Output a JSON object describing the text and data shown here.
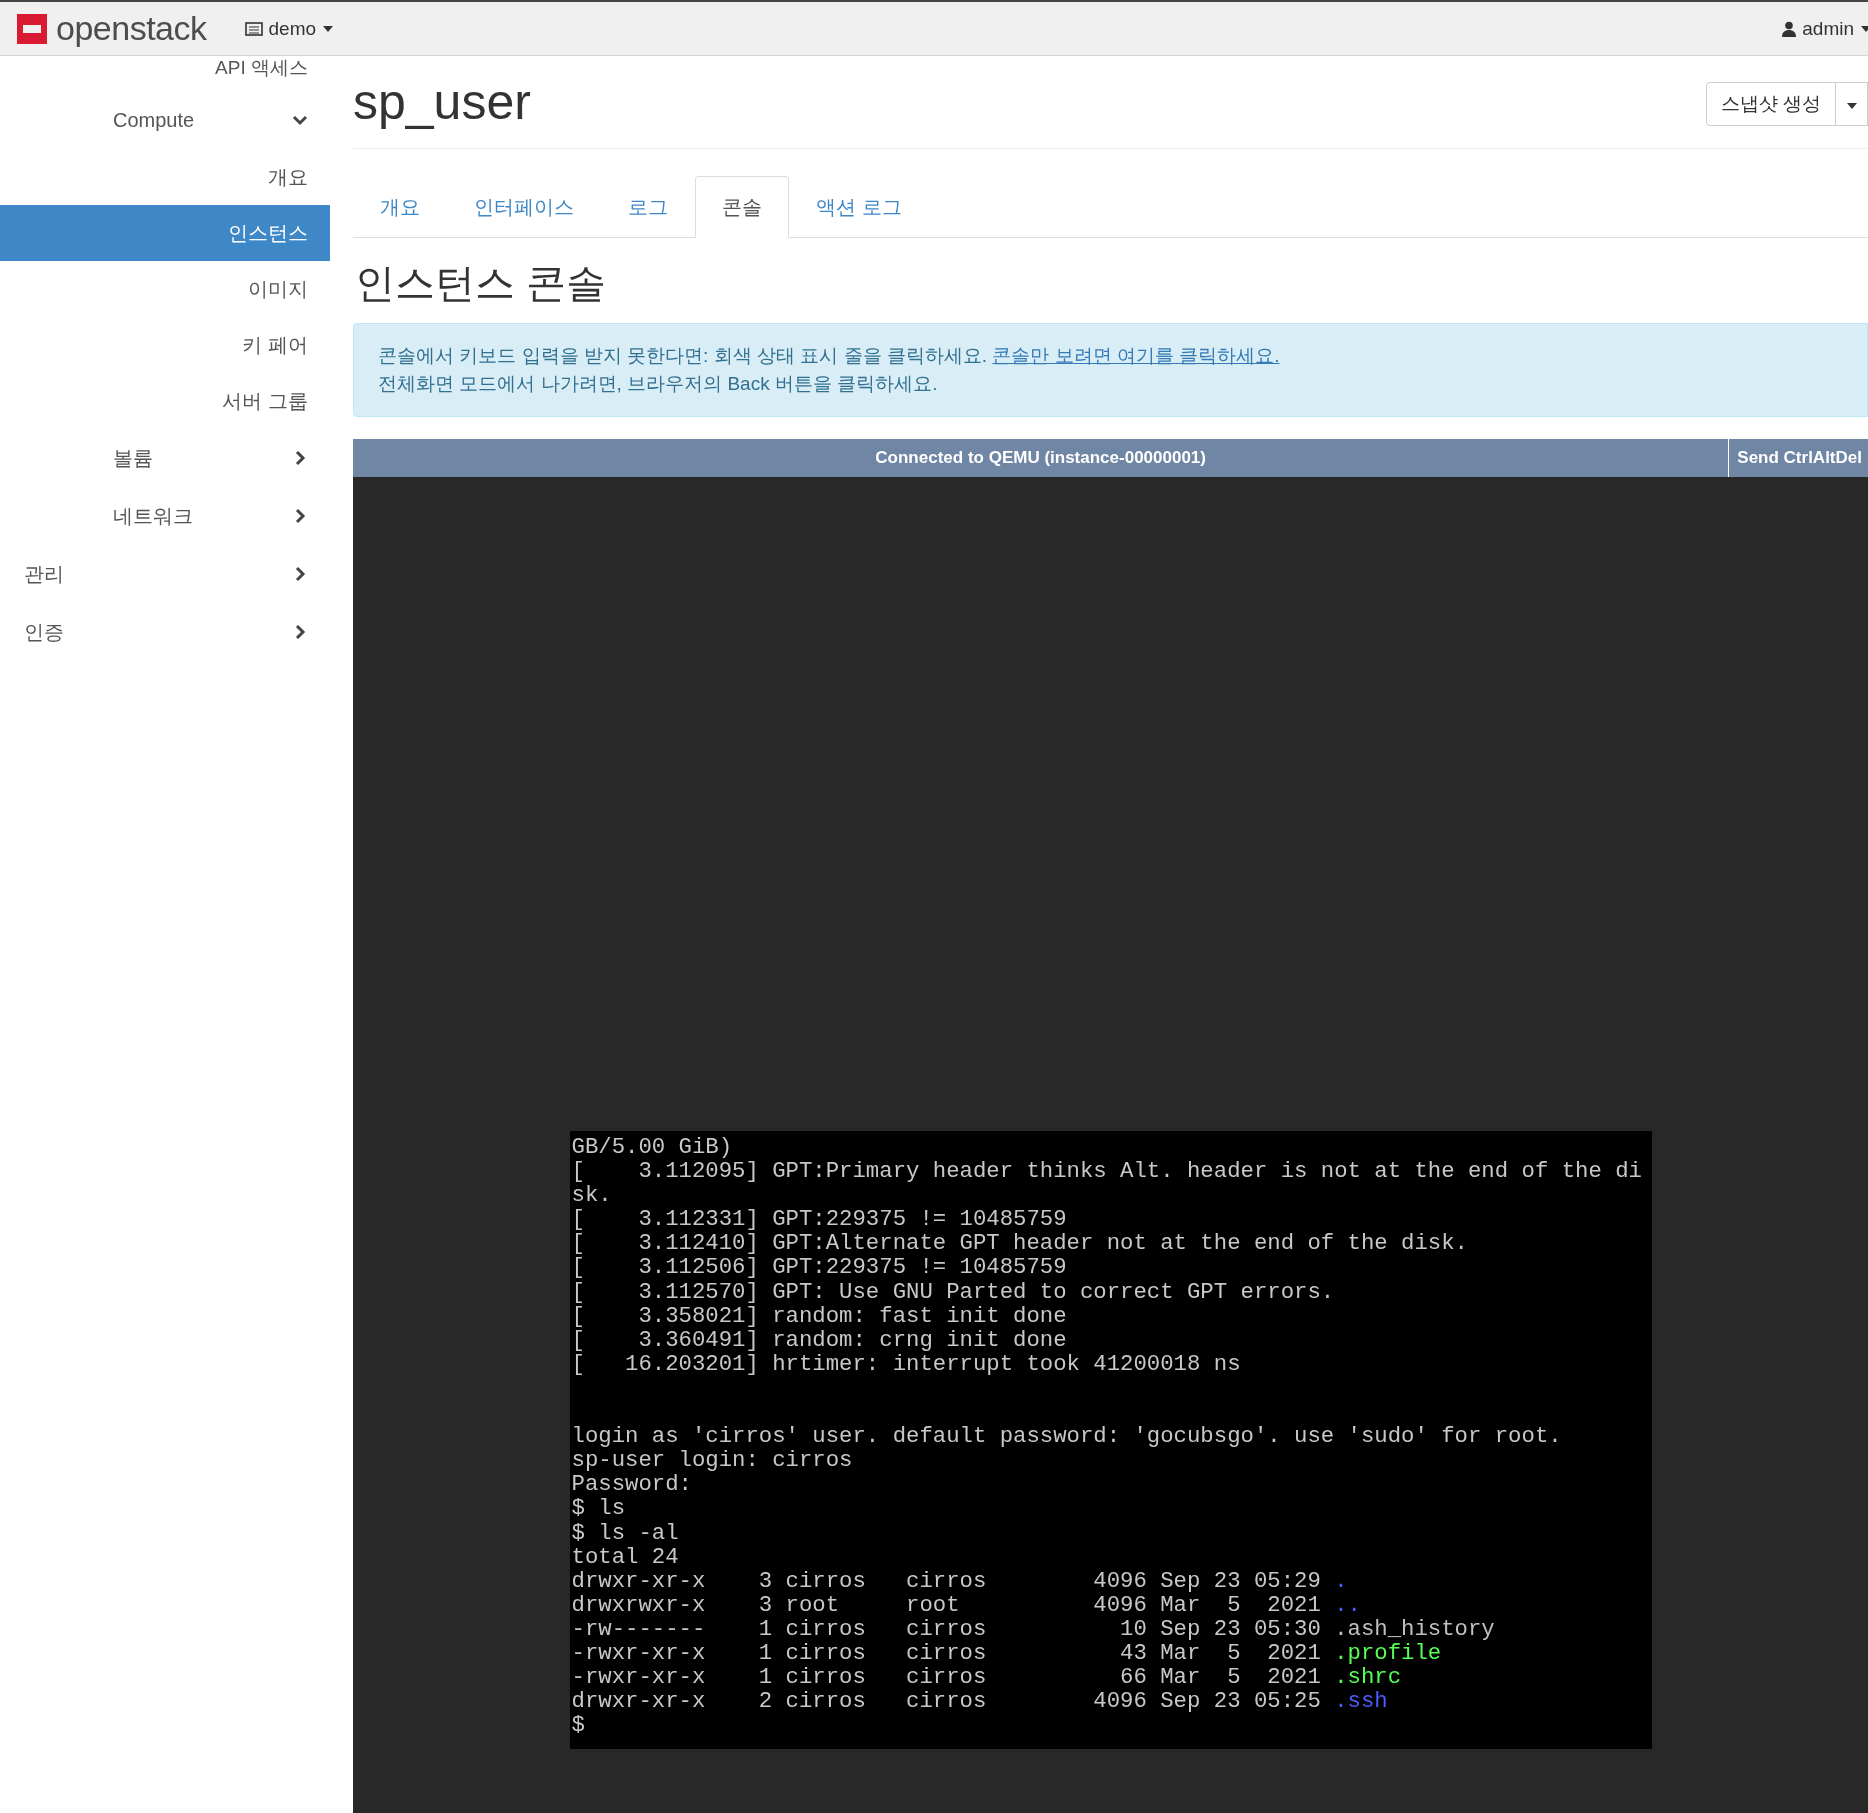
{
  "header": {
    "logo": "openstack",
    "project": "demo",
    "user": "admin"
  },
  "sidebar": {
    "items": [
      {
        "label": "API 액세스",
        "kind": "sub",
        "selected": false
      },
      {
        "label": "Compute",
        "kind": "group",
        "expanded": true,
        "selected": false
      },
      {
        "label": "개요",
        "kind": "sub",
        "selected": false
      },
      {
        "label": "인스턴스",
        "kind": "sub",
        "selected": true
      },
      {
        "label": "이미지",
        "kind": "sub",
        "selected": false
      },
      {
        "label": "키 페어",
        "kind": "sub",
        "selected": false
      },
      {
        "label": "서버 그룹",
        "kind": "sub",
        "selected": false
      },
      {
        "label": "볼륨",
        "kind": "group",
        "expanded": false,
        "selected": false
      },
      {
        "label": "네트워크",
        "kind": "group",
        "expanded": false,
        "selected": false
      },
      {
        "label": "관리",
        "kind": "top",
        "expanded": false,
        "selected": false
      },
      {
        "label": "인증",
        "kind": "top",
        "expanded": false,
        "selected": false
      }
    ]
  },
  "page": {
    "title": "sp_user",
    "action_button": "스냅샷 생성"
  },
  "tabs": [
    {
      "label": "개요",
      "selected": false
    },
    {
      "label": "인터페이스",
      "selected": false
    },
    {
      "label": "로그",
      "selected": false
    },
    {
      "label": "콘솔",
      "selected": true
    },
    {
      "label": "액션 로그",
      "selected": false
    }
  ],
  "section_title": "인스턴스 콘솔",
  "alert": {
    "text": "콘솔에서 키보드 입력을 받지 못한다면: 회색 상태 표시 줄을 클릭하세요.",
    "link": "콘솔만 보려면 여기를 클릭하세요.",
    "text2": "전체화면 모드에서 나가려면, 브라우저의 Back 버튼을 클릭하세요."
  },
  "console": {
    "status": "Connected to QEMU (instance-00000001)",
    "button": "Send CtrlAltDel",
    "lines": [
      {
        "kind": "text",
        "text": "GB/5.00 GiB)"
      },
      {
        "kind": "text",
        "text": "[    3.112095] GPT:Primary header thinks Alt. header is not at the end of the di"
      },
      {
        "kind": "text",
        "text": "sk."
      },
      {
        "kind": "text",
        "text": "[    3.112331] GPT:229375 != 10485759"
      },
      {
        "kind": "text",
        "text": "[    3.112410] GPT:Alternate GPT header not at the end of the disk."
      },
      {
        "kind": "text",
        "text": "[    3.112506] GPT:229375 != 10485759"
      },
      {
        "kind": "text",
        "text": "[    3.112570] GPT: Use GNU Parted to correct GPT errors."
      },
      {
        "kind": "text",
        "text": "[    3.358021] random: fast init done"
      },
      {
        "kind": "text",
        "text": "[    3.360491] random: crng init done"
      },
      {
        "kind": "text",
        "text": "[   16.203201] hrtimer: interrupt took 41200018 ns"
      },
      {
        "kind": "blank"
      },
      {
        "kind": "blank"
      },
      {
        "kind": "text",
        "text": "login as 'cirros' user. default password: 'gocubsgo'. use 'sudo' for root."
      },
      {
        "kind": "text",
        "text": "sp-user login: cirros"
      },
      {
        "kind": "text",
        "text": "Password:"
      },
      {
        "kind": "text",
        "text": "$ ls"
      },
      {
        "kind": "text",
        "text": "$ ls -al"
      },
      {
        "kind": "text",
        "text": "total 24"
      },
      {
        "kind": "file",
        "text": "drwxr-xr-x    3 cirros   cirros        4096 Sep 23 05:29 ",
        "file": ".",
        "color": "#4b5bff"
      },
      {
        "kind": "file",
        "text": "drwxrwxr-x    3 root     root          4096 Mar  5  2021 ",
        "file": "..",
        "color": "#4b5bff"
      },
      {
        "kind": "file",
        "text": "-rw-------    1 cirros   cirros          10 Sep 23 05:30 ",
        "file": ".ash_history",
        "color": "#c0c0c0"
      },
      {
        "kind": "file",
        "text": "-rwxr-xr-x    1 cirros   cirros          43 Mar  5  2021 ",
        "file": ".profile",
        "color": "#55ff55"
      },
      {
        "kind": "file",
        "text": "-rwxr-xr-x    1 cirros   cirros          66 Mar  5  2021 ",
        "file": ".shrc",
        "color": "#55ff55"
      },
      {
        "kind": "file",
        "text": "drwxr-xr-x    2 cirros   cirros        4096 Sep 23 05:25 ",
        "file": ".ssh",
        "color": "#4b5bff"
      },
      {
        "kind": "text",
        "text": "$"
      }
    ]
  }
}
